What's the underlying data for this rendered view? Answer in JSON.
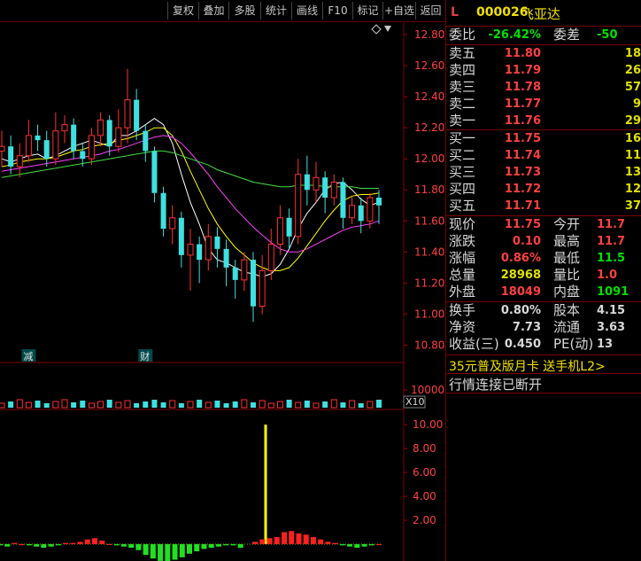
{
  "toolbar": {
    "buttons": [
      {
        "name": "fuquan-button",
        "label": "复权"
      },
      {
        "name": "diejia-button",
        "label": "叠加"
      },
      {
        "name": "duogu-button",
        "label": "多股"
      },
      {
        "name": "tongji-button",
        "label": "统计"
      },
      {
        "name": "huaxian-button",
        "label": "画线"
      },
      {
        "name": "f10-button",
        "label": "F10"
      },
      {
        "name": "biaoji-button",
        "label": "标记"
      },
      {
        "name": "add-watch-button",
        "label": "+自选"
      },
      {
        "name": "return-button",
        "label": "返回"
      }
    ]
  },
  "quote": {
    "market_letter": "L",
    "code": "000026",
    "name": "飞亚达",
    "weibi": {
      "label": "委比",
      "value": "-26.42%",
      "label2": "委差",
      "value2": "-50"
    },
    "sell": [
      {
        "label": "卖五",
        "price": "11.80",
        "vol": "18"
      },
      {
        "label": "卖四",
        "price": "11.79",
        "vol": "26"
      },
      {
        "label": "卖三",
        "price": "11.78",
        "vol": "57"
      },
      {
        "label": "卖二",
        "price": "11.77",
        "vol": "9"
      },
      {
        "label": "卖一",
        "price": "11.76",
        "vol": "29"
      }
    ],
    "buy": [
      {
        "label": "买一",
        "price": "11.75",
        "vol": "16"
      },
      {
        "label": "买二",
        "price": "11.74",
        "vol": "11"
      },
      {
        "label": "买三",
        "price": "11.73",
        "vol": "13"
      },
      {
        "label": "买四",
        "price": "11.72",
        "vol": "12"
      },
      {
        "label": "买五",
        "price": "11.71",
        "vol": "37"
      }
    ],
    "stats": [
      {
        "l1": "现价",
        "v1": "11.75",
        "c1": "#ff4040",
        "l2": "今开",
        "v2": "11.7",
        "c2": "#ff4040"
      },
      {
        "l1": "涨跌",
        "v1": "0.10",
        "c1": "#ff4040",
        "l2": "最高",
        "v2": "11.7",
        "c2": "#ff4040"
      },
      {
        "l1": "涨幅",
        "v1": "0.86%",
        "c1": "#ff4040",
        "l2": "最低",
        "v2": "11.5",
        "c2": "#00e000"
      },
      {
        "l1": "总量",
        "v1": "28968",
        "c1": "#e0e000",
        "l2": "量比",
        "v2": "1.0",
        "c2": "#ff4040"
      },
      {
        "l1": "外盘",
        "v1": "18049",
        "c1": "#ff4040",
        "l2": "内盘",
        "v2": "1091",
        "c2": "#00e000"
      }
    ],
    "stats2": [
      {
        "l1": "换手",
        "v1": "0.80%",
        "c1": "#d8d8d8",
        "l2": "股本",
        "v2": "4.15",
        "c2": "#d8d8d8"
      },
      {
        "l1": "净资",
        "v1": "7.73",
        "c1": "#d8d8d8",
        "l2": "流通",
        "v2": "3.63",
        "c2": "#d8d8d8"
      },
      {
        "l1": "收益(三)",
        "v1": "0.450",
        "c1": "#d8d8d8",
        "l2": "PE(动)",
        "v2": "13",
        "c2": "#d8d8d8"
      }
    ],
    "promo": "35元普及版月卡 送手机L2>",
    "connection": "行情连接已断开"
  },
  "chart_data": [
    {
      "type": "candlestick",
      "y_ticks": [
        "12.80",
        "12.60",
        "12.40",
        "12.20",
        "12.00",
        "11.80",
        "11.60",
        "11.40",
        "11.20",
        "11.00",
        "10.80"
      ],
      "ylim": [
        10.7,
        12.88
      ],
      "event_markers": [
        {
          "index": 3,
          "label": "减"
        },
        {
          "index": 16,
          "label": "财"
        }
      ],
      "ma": [
        {
          "color": "#ffffff",
          "values": [
            12.0,
            11.98,
            12.0,
            12.02,
            12.03,
            12.0,
            12.02,
            12.05,
            12.08,
            12.1,
            12.12,
            12.1,
            12.08,
            12.15,
            12.15,
            12.18,
            12.22,
            12.26,
            12.22,
            12.1,
            11.9,
            11.72,
            11.58,
            11.42,
            11.35,
            11.33,
            11.3,
            11.27,
            11.26,
            11.24,
            11.26,
            11.32,
            11.42,
            11.55,
            11.65,
            11.72,
            11.8,
            11.84,
            11.85,
            11.8,
            11.74,
            11.7,
            11.72
          ]
        },
        {
          "color": "#ffff00",
          "values": [
            11.95,
            11.96,
            11.98,
            11.99,
            12.0,
            12.0,
            12.01,
            12.03,
            12.05,
            12.06,
            12.08,
            12.09,
            12.1,
            12.12,
            12.13,
            12.15,
            12.17,
            12.2,
            12.2,
            12.15,
            12.05,
            11.92,
            11.8,
            11.68,
            11.58,
            11.5,
            11.43,
            11.38,
            11.33,
            11.3,
            11.28,
            11.28,
            11.3,
            11.36,
            11.44,
            11.52,
            11.6,
            11.67,
            11.73,
            11.76,
            11.77,
            11.77,
            11.78
          ]
        },
        {
          "color": "#ff40ff",
          "values": [
            11.92,
            11.93,
            11.94,
            11.95,
            11.96,
            11.97,
            11.98,
            11.99,
            12.0,
            12.01,
            12.02,
            12.03,
            12.05,
            12.06,
            12.08,
            12.1,
            12.12,
            12.14,
            12.15,
            12.14,
            12.1,
            12.04,
            11.97,
            11.9,
            11.82,
            11.75,
            11.68,
            11.62,
            11.56,
            11.51,
            11.46,
            11.42,
            11.4,
            11.4,
            11.42,
            11.45,
            11.48,
            11.51,
            11.54,
            11.56,
            11.57,
            11.58,
            11.6
          ]
        },
        {
          "color": "#40e040",
          "values": [
            11.88,
            11.89,
            11.9,
            11.91,
            11.92,
            11.93,
            11.94,
            11.95,
            11.96,
            11.97,
            11.98,
            11.99,
            12.0,
            12.01,
            12.02,
            12.03,
            12.04,
            12.05,
            12.05,
            12.04,
            12.02,
            12.0,
            11.98,
            11.96,
            11.93,
            11.91,
            11.89,
            11.87,
            11.85,
            11.84,
            11.83,
            11.82,
            11.82,
            11.83,
            11.83,
            11.83,
            11.82,
            11.82,
            11.82,
            11.82,
            11.81,
            11.81,
            11.81
          ]
        }
      ],
      "candles": [
        [
          12.05,
          12.08,
          12.18,
          11.95
        ],
        [
          12.08,
          11.95,
          12.15,
          11.9
        ],
        [
          11.95,
          12.02,
          12.1,
          11.88
        ],
        [
          12.02,
          12.15,
          12.25,
          11.98
        ],
        [
          12.15,
          12.12,
          12.22,
          12.05
        ],
        [
          12.12,
          12.0,
          12.18,
          11.95
        ],
        [
          12.0,
          12.18,
          12.3,
          11.96
        ],
        [
          12.18,
          12.22,
          12.28,
          12.1
        ],
        [
          12.22,
          12.05,
          12.26,
          12.0
        ],
        [
          12.05,
          12.0,
          12.1,
          11.95
        ],
        [
          12.0,
          12.15,
          12.2,
          11.96
        ],
        [
          12.15,
          12.25,
          12.3,
          12.08
        ],
        [
          12.25,
          12.08,
          12.28,
          12.02
        ],
        [
          12.08,
          12.2,
          12.32,
          12.04
        ],
        [
          12.2,
          12.38,
          12.58,
          12.1
        ],
        [
          12.38,
          12.18,
          12.45,
          12.12
        ],
        [
          12.18,
          12.05,
          12.22,
          11.98
        ],
        [
          12.05,
          11.78,
          12.08,
          11.72
        ],
        [
          11.78,
          11.55,
          11.82,
          11.5
        ],
        [
          11.55,
          11.62,
          11.7,
          11.45
        ],
        [
          11.62,
          11.38,
          11.66,
          11.3
        ],
        [
          11.38,
          11.45,
          11.55,
          11.15
        ],
        [
          11.45,
          11.35,
          11.5,
          11.2
        ],
        [
          11.35,
          11.5,
          11.58,
          11.28
        ],
        [
          11.5,
          11.42,
          11.56,
          11.3
        ],
        [
          11.42,
          11.3,
          11.48,
          11.18
        ],
        [
          11.3,
          11.22,
          11.35,
          11.1
        ],
        [
          11.22,
          11.35,
          11.4,
          11.15
        ],
        [
          11.35,
          11.05,
          11.4,
          10.95
        ],
        [
          11.05,
          11.28,
          11.38,
          11.0
        ],
        [
          11.28,
          11.45,
          11.55,
          11.22
        ],
        [
          11.45,
          11.62,
          11.7,
          11.38
        ],
        [
          11.62,
          11.5,
          11.68,
          11.42
        ],
        [
          11.5,
          11.9,
          12.0,
          11.45
        ],
        [
          11.9,
          11.8,
          12.02,
          11.7
        ],
        [
          11.8,
          11.88,
          11.98,
          11.72
        ],
        [
          11.88,
          11.75,
          11.92,
          11.65
        ],
        [
          11.75,
          11.85,
          11.9,
          11.7
        ],
        [
          11.85,
          11.62,
          11.88,
          11.55
        ],
        [
          11.62,
          11.7,
          11.76,
          11.58
        ],
        [
          11.7,
          11.6,
          11.75,
          11.52
        ],
        [
          11.6,
          11.75,
          11.78,
          11.55
        ],
        [
          11.75,
          11.7,
          11.8,
          11.58
        ]
      ]
    },
    {
      "type": "bar",
      "subtitle": "X10",
      "y_ticks": [
        "10000"
      ]
    },
    {
      "type": "bar",
      "y_ticks": [
        "10.00",
        "8.00",
        "6.00",
        "4.00",
        "2.00"
      ],
      "ylim": [
        0,
        11.2
      ],
      "spike": {
        "index": 34,
        "value": 10.0
      },
      "values": [
        -0.1,
        -0.2,
        0.1,
        0.0,
        -0.1,
        -0.2,
        -0.3,
        -0.2,
        -0.1,
        0.1,
        0.1,
        0.2,
        0.4,
        0.5,
        0.3,
        0.0,
        -0.1,
        -0.2,
        -0.3,
        -0.5,
        -0.9,
        -1.2,
        -1.4,
        -1.5,
        -1.3,
        -1.1,
        -0.8,
        -0.6,
        -0.4,
        -0.3,
        -0.2,
        -0.1,
        -0.1,
        -0.3,
        10.0,
        0.2,
        0.4,
        0.5,
        0.6,
        1.0,
        1.1,
        0.9,
        0.8,
        0.6,
        0.4,
        0.2,
        0.1,
        -0.1,
        -0.2,
        -0.3,
        -0.2,
        -0.1,
        0.0
      ]
    }
  ]
}
